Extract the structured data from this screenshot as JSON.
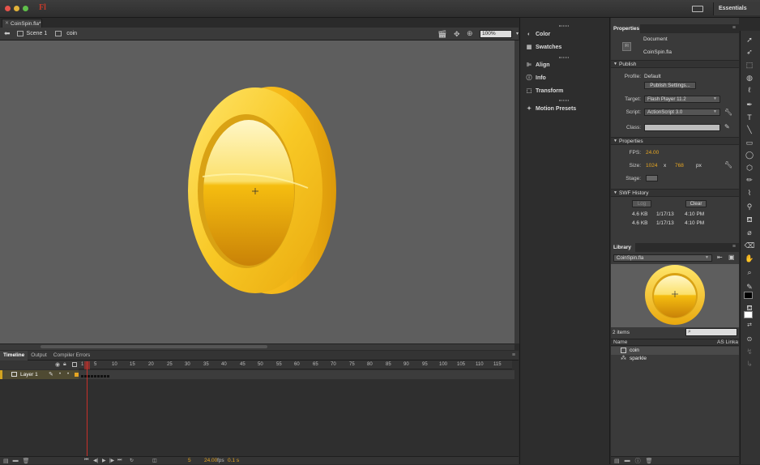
{
  "app": {
    "logo": "Fl",
    "workspace": "Essentials"
  },
  "document_tab": {
    "label": "CoinSpin.fla*"
  },
  "edit_bar": {
    "scene": "Scene 1",
    "symbol": "coin",
    "zoom": "100%"
  },
  "mid_panel": {
    "items": [
      {
        "label": "Color",
        "icon": "color-wheel-icon"
      },
      {
        "label": "Swatches",
        "icon": "swatches-icon"
      },
      {
        "label": "Align",
        "icon": "align-icon"
      },
      {
        "label": "Info",
        "icon": "info-icon"
      },
      {
        "label": "Transform",
        "icon": "transform-icon"
      },
      {
        "label": "Motion Presets",
        "icon": "motion-presets-icon"
      }
    ]
  },
  "properties": {
    "tab": "Properties",
    "doc_type": "Document",
    "doc_name": "CoinSpin.fla",
    "publish": {
      "header": "Publish",
      "profile_label": "Profile:",
      "profile_value": "Default",
      "settings_button": "Publish Settings...",
      "target_label": "Target:",
      "target_value": "Flash Player 11.2",
      "script_label": "Script:",
      "script_value": "ActionScript 3.0",
      "class_label": "Class:"
    },
    "props": {
      "header": "Properties",
      "fps_label": "FPS:",
      "fps_value": "24.00",
      "size_label": "Size:",
      "width": "1024",
      "x": "x",
      "height": "768",
      "unit": "px",
      "stage_label": "Stage:",
      "stage_color": "#666666"
    },
    "swf_history": {
      "header": "SWF History",
      "log_button": "Log",
      "clear_button": "Clear",
      "rows": [
        {
          "size": "4.6 KB",
          "date": "1/17/13",
          "time": "4:10 PM"
        },
        {
          "size": "4.6 KB",
          "date": "1/17/13",
          "time": "4:10 PM"
        }
      ]
    }
  },
  "library": {
    "tab": "Library",
    "file": "CoinSpin.fla",
    "count": "2 items",
    "col_name": "Name",
    "col_linkage": "AS Linka",
    "items": [
      {
        "name": "coin",
        "icon": "graphic-symbol-icon"
      },
      {
        "name": "sparkle",
        "icon": "movieclip-symbol-icon"
      }
    ]
  },
  "timeline": {
    "tabs": [
      "Timeline",
      "Output",
      "Compiler Errors"
    ],
    "layer_name": "Layer 1",
    "ruler": [
      "1",
      "5",
      "10",
      "15",
      "20",
      "25",
      "30",
      "35",
      "40",
      "45",
      "50",
      "55",
      "60",
      "65",
      "70",
      "75",
      "80",
      "85",
      "90",
      "95",
      "100",
      "105",
      "110",
      "115"
    ],
    "current_frame": "5",
    "fps": "24.00",
    "fps_unit": "fps",
    "elapsed": "0.1 s"
  },
  "colors": {
    "accent": "#e6a623",
    "coin": "#f5c518",
    "playhead": "#c8302a",
    "stage": "#5e5e5e"
  }
}
